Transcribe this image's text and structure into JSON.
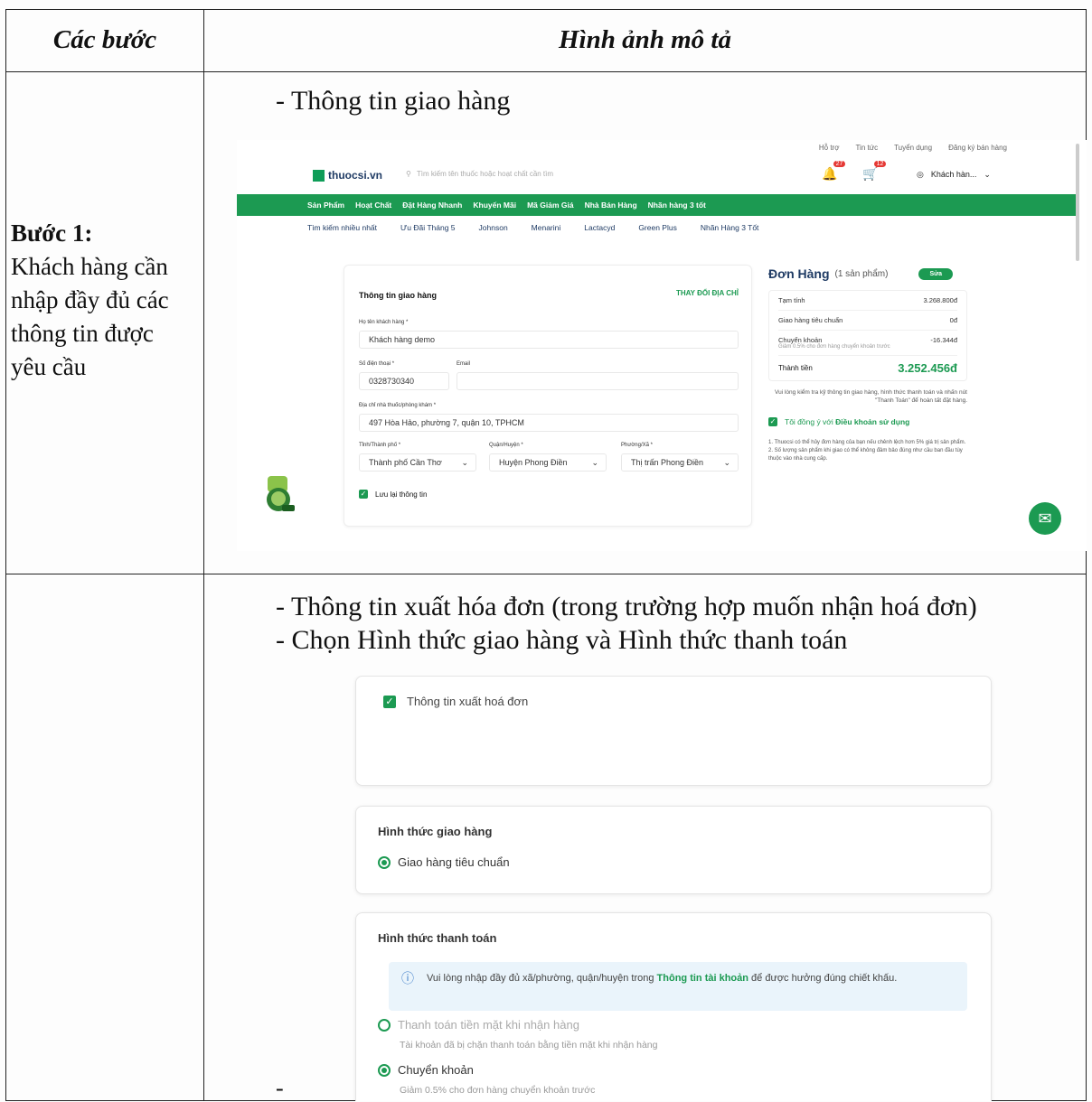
{
  "table": {
    "header_steps": "Các bước",
    "header_images": "Hình ảnh mô tả",
    "step1_title": "Bước 1:",
    "step1_desc": "Khách hàng cần nhập đầy đủ các thông tin được yêu cầu"
  },
  "row1": {
    "caption": "- Thông tin giao hàng"
  },
  "row2": {
    "caption1": "- Thông tin xuất hóa đơn (trong trường hợp muốn nhận hoá đơn)",
    "caption2": "- Chọn Hình thức giao hàng và Hình thức thanh toán",
    "trailing_dash": "-"
  },
  "screenshot1": {
    "toplinks": [
      "Hỗ trợ",
      "Tin tức",
      "Tuyển dụng",
      "Đăng ký bán hàng"
    ],
    "logo": "thuocsi.vn",
    "search_placeholder": "Tìm kiếm tên thuốc hoặc hoạt chất cần tìm",
    "bell_badge": "27",
    "cart_badge": "12",
    "account_name": "Khách hàn...",
    "greenbar": [
      "Sản Phẩm",
      "Hoạt Chất",
      "Đặt Hàng Nhanh",
      "Khuyến Mãi",
      "Mã Giảm Giá",
      "Nhà Bán Hàng",
      "Nhãn hàng 3 tốt"
    ],
    "quicknav": [
      "Tìm kiếm nhiều nhất",
      "Ưu Đãi Tháng 5",
      "Johnson",
      "Menarini",
      "Lactacyd",
      "Green Plus",
      "Nhãn Hàng 3 Tốt"
    ],
    "form": {
      "title": "Thông tin giao hàng",
      "change_address": "THAY ĐỔI ĐỊA CHỈ",
      "name_label": "Họ tên khách hàng *",
      "name_value": "Khách hàng demo",
      "phone_label": "Số điện thoại *",
      "phone_value": "0328730340",
      "email_label": "Email",
      "email_value": "",
      "address_label": "Địa chỉ nhà thuốc/phòng khám *",
      "address_value": "497 Hòa Hảo, phường 7, quận 10, TPHCM",
      "province_label": "Tỉnh/Thành phố *",
      "province_value": "Thành phố Cần Thơ",
      "district_label": "Quận/Huyện *",
      "district_value": "Huyện Phong Điền",
      "ward_label": "Phường/Xã *",
      "ward_value": "Thị trấn Phong Điền",
      "save_info": "Lưu lại thông tin"
    },
    "order": {
      "title": "Đơn Hàng",
      "count": "(1 sản phẩm)",
      "edit": "Sửa",
      "subtotal_label": "Tạm tính",
      "subtotal_value": "3.268.800đ",
      "shipping_label": "Giao hàng tiêu chuẩn",
      "shipping_value": "0đ",
      "transfer_label": "Chuyển khoản",
      "transfer_sub": "Giảm 0.5% cho đơn hàng chuyển khoản trước",
      "transfer_value": "-16.344đ",
      "total_label": "Thành tiền",
      "total_value": "3.252.456đ",
      "note": "Vui lòng kiểm tra kỹ thông tin giao hàng, hình thức thanh toán và nhấn nút \"Thanh Toán\" để hoàn tất đặt hàng.",
      "agree_prefix": "Tôi đồng ý với",
      "agree_link": "Điều khoản sử dụng",
      "notes2": "1. Thuocsi có thể hủy đơn hàng của bạn nếu chênh lệch hơn 5% giá trị sản phẩm. 2. Số lượng sản phẩm khi giao có thể không đảm bảo đúng như cầu ban đầu tùy thuộc vào nhà cung cấp."
    }
  },
  "screenshot2": {
    "invoice_label": "Thông tin xuất hoá đơn",
    "shipping_title": "Hình thức giao hàng",
    "shipping_option": "Giao hàng tiêu chuẩn",
    "payment_title": "Hình thức thanh toán",
    "info_prefix": "Vui lòng nhập đầy đủ xã/phường, quận/huyện trong",
    "info_link": "Thông tin tài khoản",
    "info_suffix": "để được hưởng đúng chiết khấu.",
    "cash_option": "Thanh toán tiền mặt khi nhận hàng",
    "cash_sub": "Tài khoản đã bị chặn thanh toán bằng tiền mặt khi nhận hàng",
    "transfer_option": "Chuyển khoản",
    "transfer_sub": "Giảm 0.5% cho đơn hàng chuyển khoản trước"
  },
  "colors": {
    "brand_green": "#1c9a52",
    "navy": "#1f3b64"
  }
}
